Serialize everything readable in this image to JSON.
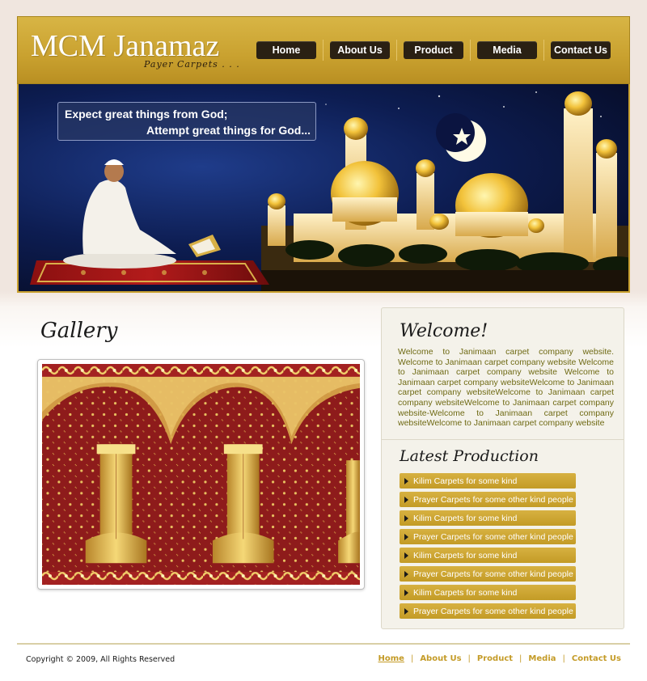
{
  "header": {
    "logo": "MCM Janamaz",
    "tagline": "Payer Carpets . . .",
    "nav": [
      {
        "label": "Home",
        "w": 74
      },
      {
        "label": "About Us",
        "w": 74
      },
      {
        "label": "Product",
        "w": 74
      },
      {
        "label": "Media",
        "w": 74
      },
      {
        "label": "Contact Us",
        "w": 74
      }
    ]
  },
  "banner": {
    "quote_line1": "Expect great things from God;",
    "quote_line2": "Attempt great things for God..."
  },
  "gallery": {
    "title": "Gallery"
  },
  "panel": {
    "welcome_title": "Welcome!",
    "welcome_text": "Welcome to Janimaan carpet company website. Welcome to Janimaan carpet company website Welcome to Janimaan carpet company website Welcome to Janimaan carpet company websiteWelcome to Janimaan carpet company websiteWelcome to Janimaan carpet company websiteWelcome to Janimaan carpet company website-Welcome to Janimaan carpet company websiteWelcome to Janimaan carpet company website",
    "latest_title": "Latest Production",
    "products": [
      "Kilim Carpets for some kind",
      "Prayer Carpets for some other kind people",
      "Kilim Carpets for some kind",
      "Prayer Carpets for some other kind people",
      "Kilim Carpets for some kind",
      "Prayer Carpets for some other kind people",
      "Kilim Carpets for some kind",
      "Prayer Carpets for some other kind people"
    ]
  },
  "footer": {
    "copyright": "Copyright © 2009, All Rights Reserved",
    "links": [
      "Home",
      "About Us",
      "Product",
      "Media",
      "Contact Us"
    ]
  },
  "colors": {
    "gold": "#c9a12f",
    "dark_button": "#2a2013",
    "olive_text": "#6f6a14",
    "link_gold": "#c49b27"
  }
}
